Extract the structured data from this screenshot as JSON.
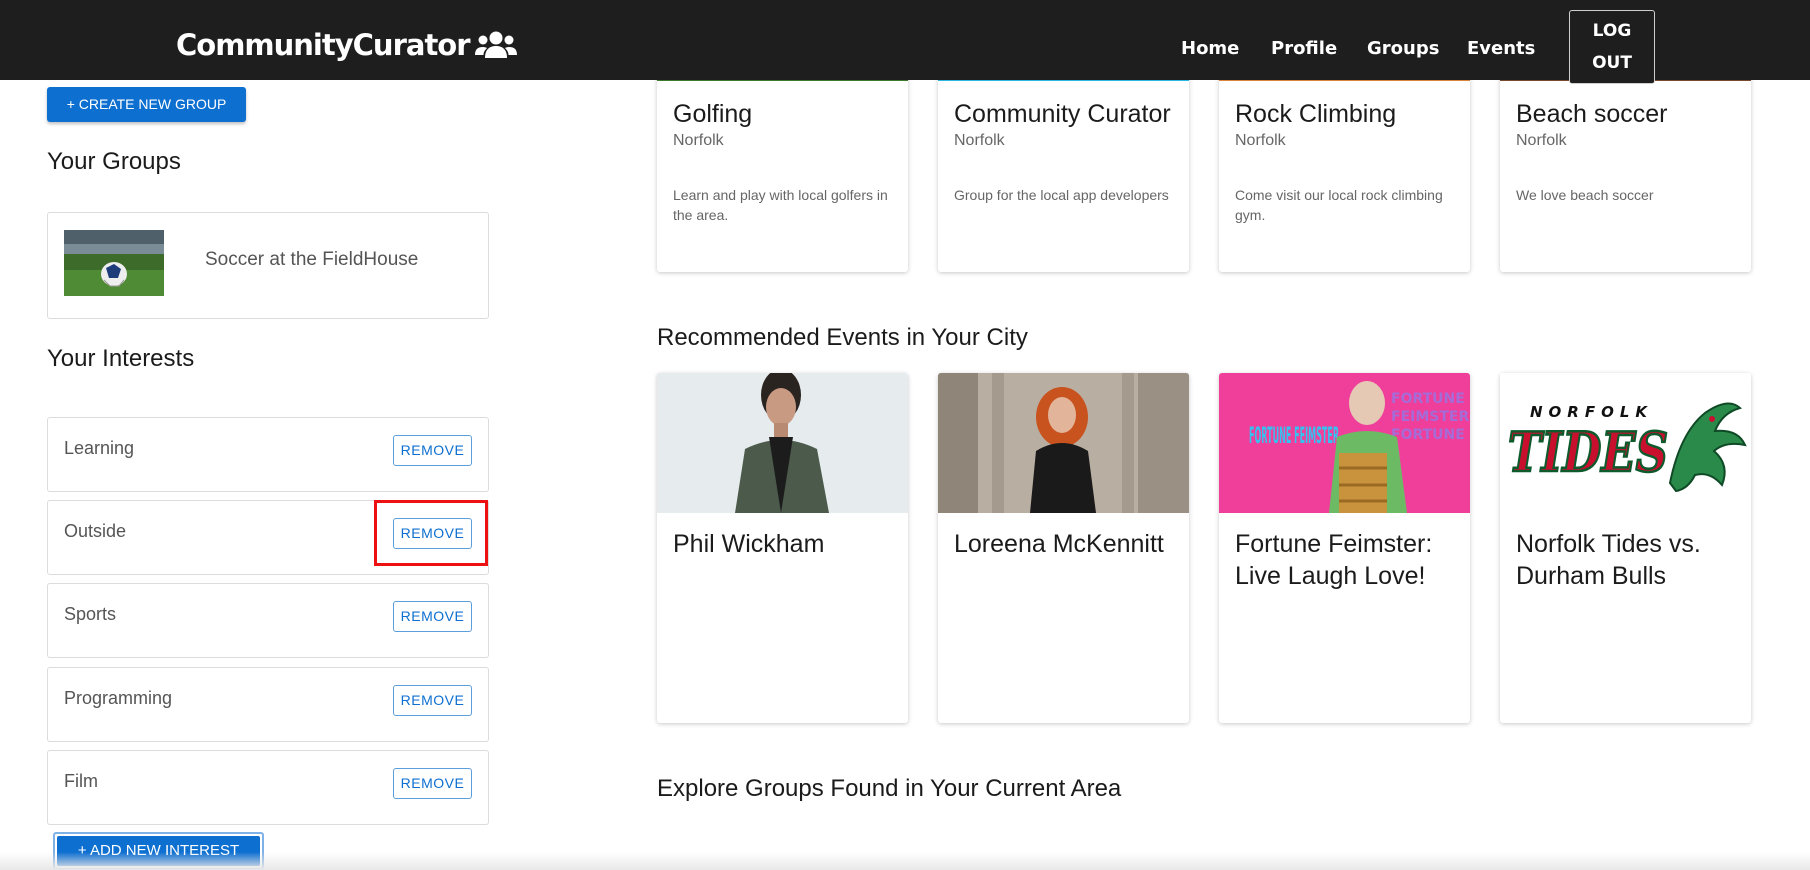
{
  "navbar": {
    "brand": "CommunityCurator",
    "brand_icon": "users-icon",
    "links": [
      "Home",
      "Profile",
      "Groups",
      "Events"
    ],
    "logout_line1": "LOG",
    "logout_line2": "OUT"
  },
  "left": {
    "create_group_label": "+ CREATE NEW GROUP",
    "your_groups_title": "Your Groups",
    "groups": [
      {
        "name": "Soccer at the FieldHouse",
        "image": "soccer-stadium-image"
      }
    ],
    "your_interests_title": "Your Interests",
    "interests": [
      {
        "label": "Learning",
        "remove_label": "REMOVE"
      },
      {
        "label": "Outside",
        "remove_label": "REMOVE"
      },
      {
        "label": "Sports",
        "remove_label": "REMOVE"
      },
      {
        "label": "Programming",
        "remove_label": "REMOVE"
      },
      {
        "label": "Film",
        "remove_label": "REMOVE"
      }
    ],
    "add_interest_label": "+ ADD NEW INTEREST"
  },
  "right": {
    "group_cards": [
      {
        "title": "Golfing",
        "city": "Norfolk",
        "description": "Learn and play with local golfers in the area.",
        "accent": "#3a7a2a"
      },
      {
        "title": "Community Curator",
        "city": "Norfolk",
        "description": "Group for the local app developers",
        "accent": "#29b6e0"
      },
      {
        "title": "Rock Climbing",
        "city": "Norfolk",
        "description": "Come visit our local rock climbing gym.",
        "accent": "#d9843a"
      },
      {
        "title": "Beach soccer",
        "city": "Norfolk",
        "description": "We love beach soccer",
        "accent": "#7a4a30"
      }
    ],
    "recommended_events_title": "Recommended Events in Your City",
    "events": [
      {
        "title": "Phil Wickham",
        "image": "phil-wickham-photo"
      },
      {
        "title": "Loreena McKennitt",
        "image": "loreena-mckennitt-photo"
      },
      {
        "title": "Fortune Feimster: Live Laugh Love!",
        "image": "fortune-feimster-poster",
        "poster_text": "FORTUNE FEIMSTER"
      },
      {
        "title": "Norfolk Tides vs. Durham Bulls",
        "image": "norfolk-tides-logo",
        "logo_top": "NORFOLK",
        "logo_main": "TIDES"
      }
    ],
    "explore_title": "Explore Groups Found in Your Current Area"
  }
}
